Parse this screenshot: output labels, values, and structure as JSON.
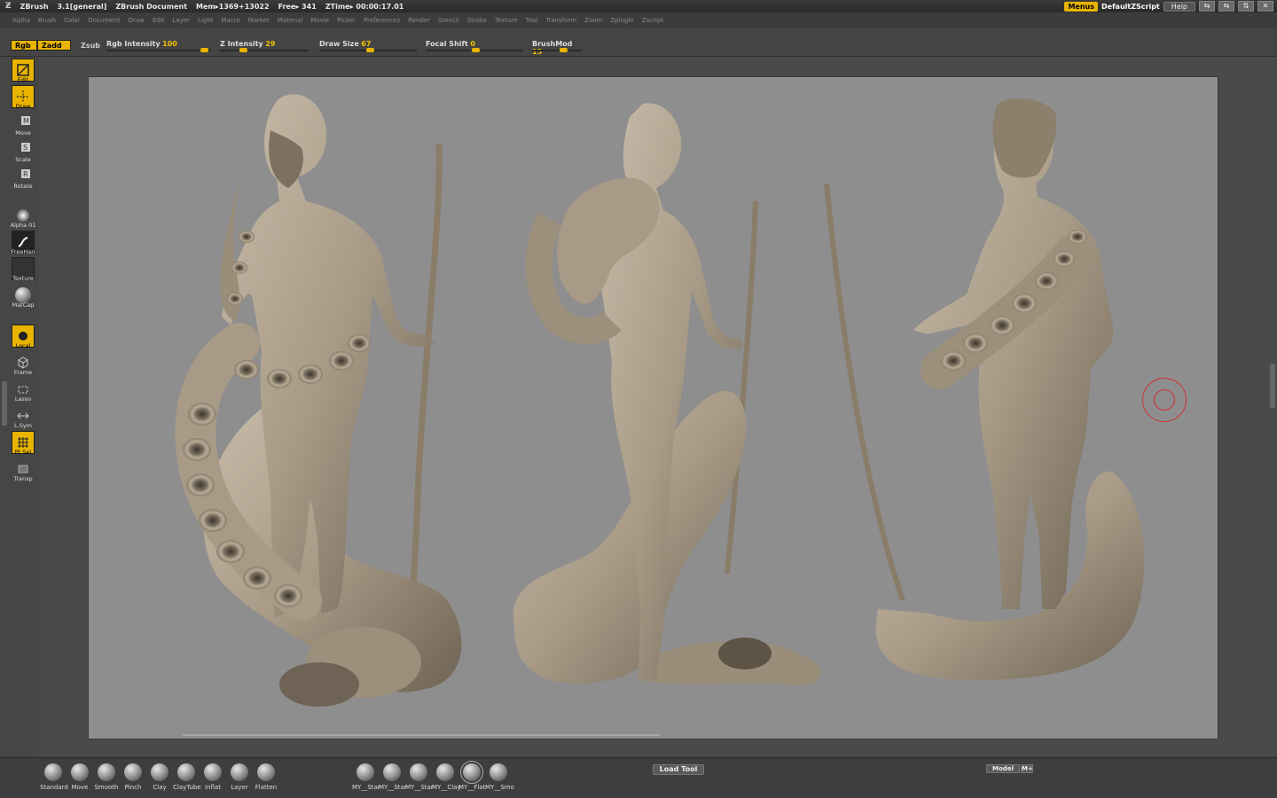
{
  "titlebar": {
    "app": "ZBrush",
    "version": "3.1[general]",
    "document": "ZBrush Document",
    "mem": "Mem▸1369+13022",
    "free": "Free▸ 341",
    "ztime": "ZTime▸ 00:00:17.01",
    "menus_label": "Menus",
    "script": "DefaultZScript",
    "help_label": "Help",
    "window_buttons": [
      "⇆",
      "⇆",
      "⇅",
      "✕"
    ]
  },
  "menubar": [
    "Alpha",
    "Brush",
    "Color",
    "Document",
    "Draw",
    "Edit",
    "Layer",
    "Light",
    "Macro",
    "Marker",
    "Material",
    "Movie",
    "Picker",
    "Preferences",
    "Render",
    "Stencil",
    "Stroke",
    "Texture",
    "Tool",
    "Transform",
    "Zoom",
    "Zplugin",
    "Zscript"
  ],
  "toolbar": {
    "rgb": "Rgb",
    "zadd": "Zadd",
    "zsub": "Zsub",
    "sliders": [
      {
        "label": "Rgb Intensity",
        "value": "100",
        "fraction": 1.0
      },
      {
        "label": "Z Intensity",
        "value": "29",
        "fraction": 0.29
      },
      {
        "label": "Draw Size",
        "value": "67",
        "fraction": 0.6
      },
      {
        "label": "Focal Shift",
        "value": "0",
        "fraction": 0.5
      },
      {
        "label": "BrushMod",
        "value": "15",
        "fraction": 0.58
      }
    ]
  },
  "left_tray": [
    {
      "label": "Edit",
      "icon": "edit-icon",
      "active": true
    },
    {
      "label": "Draw",
      "icon": "draw-icon",
      "active": true
    },
    {
      "label": "Move",
      "icon": "move-icon",
      "active": false
    },
    {
      "label": "Scale",
      "icon": "scale-icon",
      "active": false
    },
    {
      "label": "Rotate",
      "icon": "rotate-icon",
      "active": false
    },
    {
      "label": "Alpha 01",
      "icon": "alpha-icon",
      "active": false
    },
    {
      "label": "FreeHan",
      "icon": "stroke-icon",
      "active": false
    },
    {
      "label": "Texture",
      "icon": "texture-icon",
      "active": false
    },
    {
      "label": "MatCap",
      "icon": "matcap-icon",
      "active": false
    },
    {
      "label": "Local",
      "icon": "local-icon",
      "active": true
    },
    {
      "label": "Frame",
      "icon": "frame-icon",
      "active": false
    },
    {
      "label": "Lasso",
      "icon": "lasso-icon",
      "active": false
    },
    {
      "label": "L.Sym",
      "icon": "lsym-icon",
      "active": false
    },
    {
      "label": "Pt Sel",
      "icon": "ptsel-icon",
      "active": true
    },
    {
      "label": "Transp",
      "icon": "transp-icon",
      "active": false
    }
  ],
  "brushes": [
    "Standard",
    "Move",
    "Smooth",
    "Pinch",
    "Clay",
    "ClayTube",
    "Inflat",
    "Layer",
    "Flatten"
  ],
  "custom_brushes": [
    "MY__Star",
    "MY__Star",
    "MY__Star",
    "MY__Clay",
    "MY__Flat",
    "MY__Smo"
  ],
  "load_tool": "Load Tool",
  "model_label": "Model",
  "mplus_label": "M+",
  "colors": {
    "accent": "#e8b400",
    "canvas_bg": "#8e8e8e",
    "ui_bg": "#4a4a4a",
    "sculpt": "#a89a86",
    "cursor": "#d03030"
  }
}
